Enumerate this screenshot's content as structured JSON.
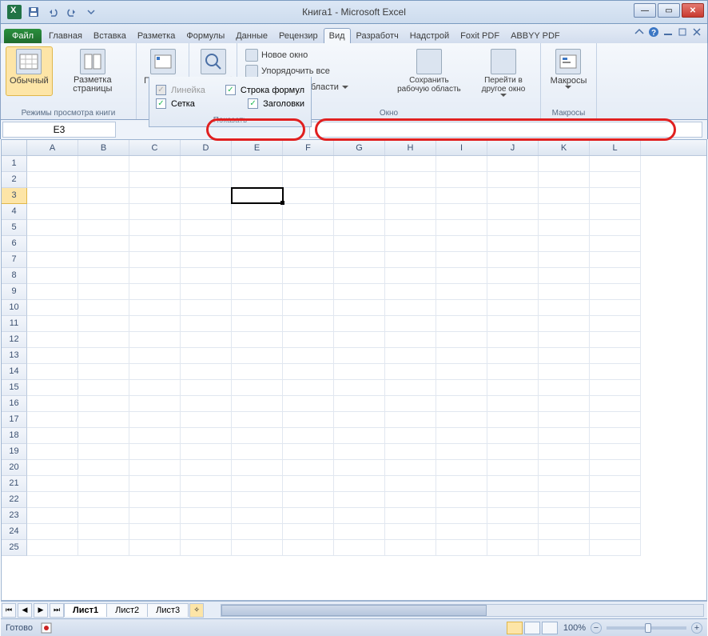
{
  "title": "Книга1 - Microsoft Excel",
  "tabs": {
    "file": "Файл",
    "items": [
      "Главная",
      "Вставка",
      "Разметка",
      "Формулы",
      "Данные",
      "Рецензир",
      "Вид",
      "Разработч",
      "Надстрой",
      "Foxit PDF",
      "ABBYY PDF"
    ],
    "active_index": 6
  },
  "ribbon": {
    "views_group": "Режимы просмотра книги",
    "normal": "Обычный",
    "page_layout": "Разметка страницы",
    "show_btn": "Показать",
    "zoom_btn": "Масштаб",
    "window_group": "Окно",
    "new_window": "Новое окно",
    "arrange_all": "Упорядочить все",
    "freeze_panes": "Закрепить области",
    "save_workspace": "Сохранить рабочую область",
    "switch_windows": "Перейти в другое окно",
    "macros_group": "Макросы",
    "macros": "Макросы"
  },
  "show_panel": {
    "ruler": "Линейка",
    "formula_bar": "Строка формул",
    "gridlines": "Сетка",
    "headings": "Заголовки",
    "label": "Показать"
  },
  "namebox": "E3",
  "columns": [
    "A",
    "B",
    "C",
    "D",
    "E",
    "F",
    "G",
    "H",
    "I",
    "J",
    "K",
    "L"
  ],
  "rows": [
    1,
    2,
    3,
    4,
    5,
    6,
    7,
    8,
    9,
    10,
    11,
    12,
    13,
    14,
    15,
    16,
    17,
    18,
    19,
    20,
    21,
    22,
    23,
    24,
    25
  ],
  "selected_cell": {
    "col": 4,
    "row": 2
  },
  "sheets": {
    "items": [
      "Лист1",
      "Лист2",
      "Лист3"
    ],
    "active": 0
  },
  "status": {
    "ready": "Готово",
    "zoom": "100%"
  }
}
